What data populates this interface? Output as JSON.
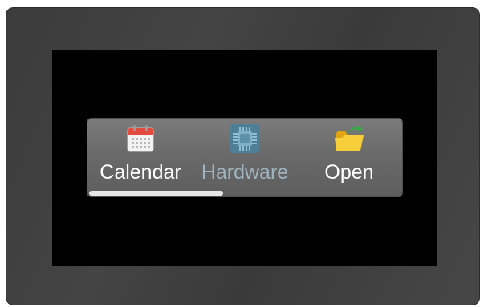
{
  "launcher": {
    "apps": [
      {
        "label": "Calendar",
        "icon": "calendar-icon",
        "state": "normal"
      },
      {
        "label": "Hardware",
        "icon": "chip-icon",
        "state": "disabled"
      },
      {
        "label": "Open",
        "icon": "open-folder-icon",
        "state": "normal"
      }
    ],
    "scroll_position": 0.0,
    "scroll_visible_fraction": 0.43
  },
  "colors": {
    "bezel": "#3f3f3f",
    "screen": "#000000",
    "launcher_bg": "#6e6e6e",
    "label_active": "#ffffff",
    "label_disabled": "#9fb3bf",
    "scroll_thumb": "#e6e6e6"
  }
}
